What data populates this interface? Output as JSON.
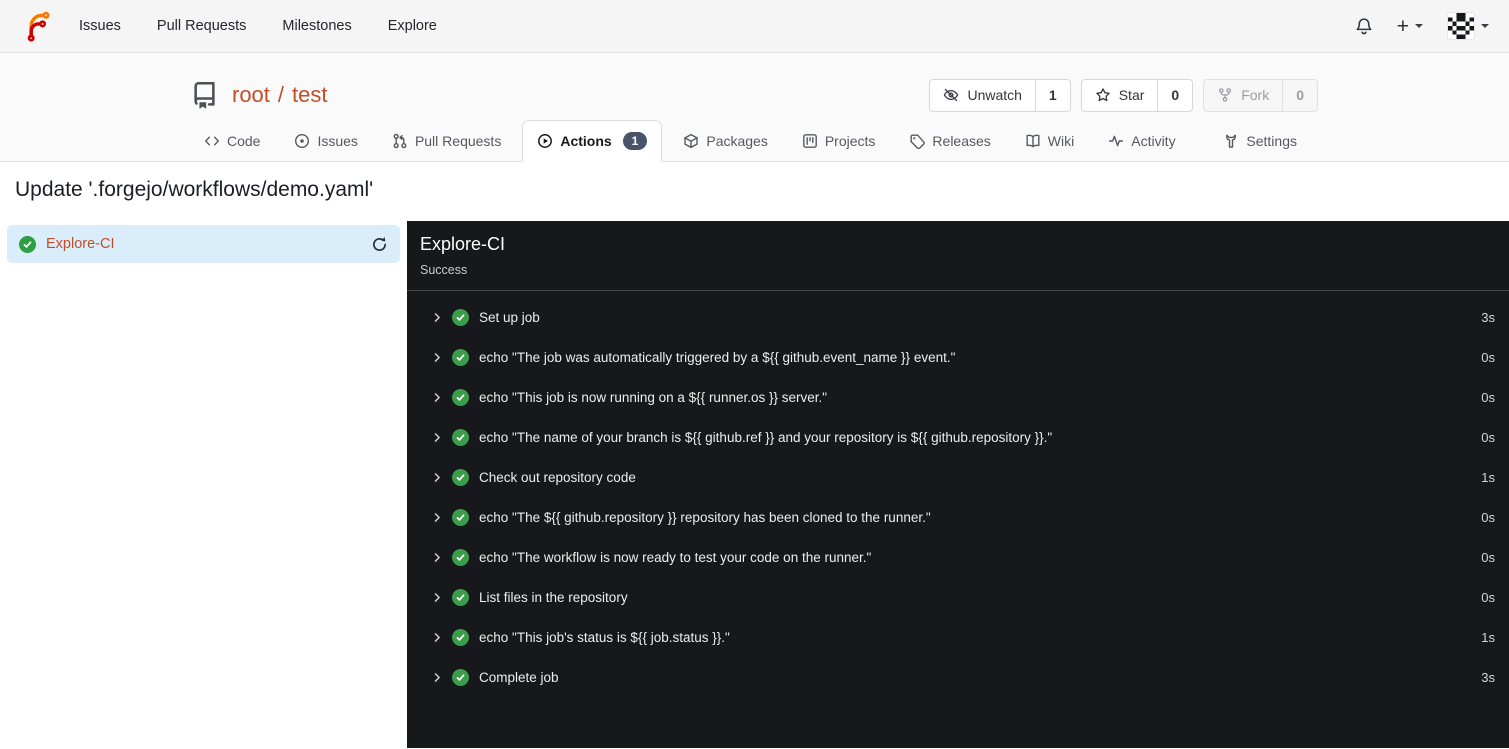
{
  "navbar": {
    "items": [
      {
        "label": "Issues"
      },
      {
        "label": "Pull Requests"
      },
      {
        "label": "Milestones"
      },
      {
        "label": "Explore"
      }
    ],
    "plus_label": "+"
  },
  "repo": {
    "owner": "root",
    "separator": "/",
    "name": "test",
    "watch": {
      "label": "Unwatch",
      "count": "1"
    },
    "star": {
      "label": "Star",
      "count": "0"
    },
    "fork": {
      "label": "Fork",
      "count": "0"
    }
  },
  "tabs": [
    {
      "label": "Code"
    },
    {
      "label": "Issues"
    },
    {
      "label": "Pull Requests"
    },
    {
      "label": "Actions",
      "badge": "1",
      "active": true
    },
    {
      "label": "Packages"
    },
    {
      "label": "Projects"
    },
    {
      "label": "Releases"
    },
    {
      "label": "Wiki"
    },
    {
      "label": "Activity"
    },
    {
      "label": "Settings"
    }
  ],
  "page": {
    "title": "Update '.forgejo/workflows/demo.yaml'"
  },
  "sidebar": {
    "jobs": [
      {
        "label": "Explore-CI",
        "status": "success"
      }
    ]
  },
  "run_panel": {
    "title": "Explore-CI",
    "status": "Success",
    "steps": [
      {
        "name": "Set up job",
        "duration": "3s"
      },
      {
        "name": "echo \"The job was automatically triggered by a ${{ github.event_name }} event.\"",
        "duration": "0s"
      },
      {
        "name": "echo \"This job is now running on a ${{ runner.os }} server.\"",
        "duration": "0s"
      },
      {
        "name": "echo \"The name of your branch is ${{ github.ref }} and your repository is ${{ github.repository }}.\"",
        "duration": "0s"
      },
      {
        "name": "Check out repository code",
        "duration": "1s"
      },
      {
        "name": "echo \"The ${{ github.repository }} repository has been cloned to the runner.\"",
        "duration": "0s"
      },
      {
        "name": "echo \"The workflow is now ready to test your code on the runner.\"",
        "duration": "0s"
      },
      {
        "name": "List files in the repository",
        "duration": "0s"
      },
      {
        "name": "echo \"This job's status is ${{ job.status }}.\"",
        "duration": "1s"
      },
      {
        "name": "Complete job",
        "duration": "3s"
      }
    ]
  },
  "icons": {
    "logo": "forgejo-logo",
    "notifications": "bell-icon",
    "create": "plus-icon",
    "user": "avatar-identicon",
    "watch": "eye-slash-icon",
    "star": "star-icon",
    "fork": "git-fork-icon",
    "job_status": "check-circle-icon",
    "rerun": "refresh-icon",
    "step_expand": "chevron-right-icon"
  },
  "colors": {
    "accent": "#c24e28",
    "success_green": "#3b9c4a",
    "panel_bg": "#17181b",
    "selected_job_bg": "#d9edfb",
    "badge_bg": "#49536a",
    "navbar_bg": "#f5f5f6",
    "header_bg": "#fafafa"
  }
}
